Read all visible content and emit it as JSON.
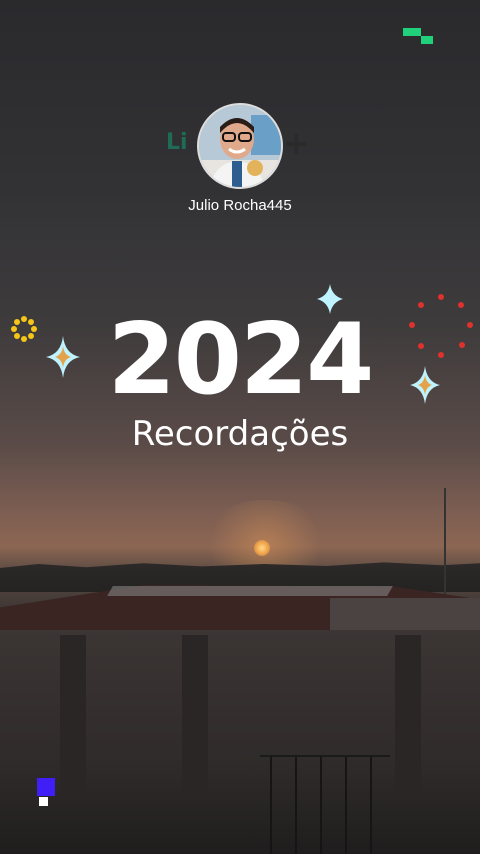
{
  "profile": {
    "username": "Julio Rocha445",
    "background_logo_text": "Li"
  },
  "memories": {
    "year": "2024",
    "subtitle": "Recordações"
  },
  "colors": {
    "green_accent": "#21d07a",
    "purple_accent": "#3f1ff5",
    "sparkle": "#bff3ff",
    "red_dots": "#e0322d",
    "yellow_ring": "#f5c518"
  }
}
